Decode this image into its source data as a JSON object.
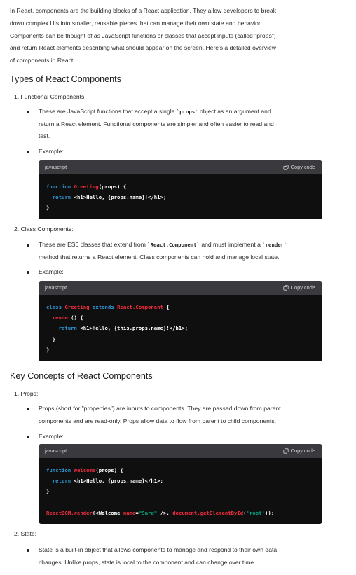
{
  "intro": [
    "In React, components are the building blocks of a React application. They allow developers to break",
    "down complex UIs into smaller, reusable pieces that can manage their own state and behavior.",
    "Components can be thought of as JavaScript functions or classes that accept inputs (called \"props\")",
    "and return React elements describing what should appear on the screen. Here's a detailed overview",
    "of components in React:"
  ],
  "section1": {
    "title": "Types of React Components",
    "item1": {
      "label": "1.  Functional Components:",
      "bullet1": {
        "line1_a": "These are JavaScript functions that accept a single ",
        "line1_code": "`props`",
        "line1_b": " object as an argument and",
        "line2": "return a React element. Functional components are simpler and often easier to read and",
        "line3": "test."
      },
      "bullet2": "Example:",
      "code": {
        "lang": "javascript",
        "copy": "Copy code",
        "l1_kw": "function ",
        "l1_fn": "Greeting",
        "l1_rest": "(props) {",
        "l2_kw": "  return ",
        "l2_rest": "<h1>Hello, {props.name}!</h1>;",
        "l3": "}"
      }
    },
    "item2": {
      "label": "2.  Class Components:",
      "bullet1": {
        "line1_a": "These are ES6 classes that extend from ",
        "line1_code1": "`React.Component`",
        "line1_b": " and must implement a ",
        "line1_code2": "`render`",
        "line2": "method that returns a React element. Class components can hold and manage local state."
      },
      "bullet2": "Example:",
      "code": {
        "lang": "javascript",
        "copy": "Copy code",
        "l1_kw": "class ",
        "l1_fn": "Greeting",
        "l1_kw2": " extends ",
        "l1_fn2": "React.Component",
        "l1_rest": " {",
        "l2_fn": "  render",
        "l2_rest": "() {",
        "l3_kw": "    return ",
        "l3_rest": "<h1>Hello, {this.props.name}!</h1>;",
        "l4": "  }",
        "l5": "}"
      }
    }
  },
  "section2": {
    "title": "Key Concepts of React Components",
    "item1": {
      "label": "1.  Props:",
      "bullet1": {
        "line1": "Props (short for \"properties\") are inputs to components. They are passed down from parent",
        "line2": "components and are read-only. Props allow data to flow from parent to child components."
      },
      "bullet2": "Example:",
      "code": {
        "lang": "javascript",
        "copy": "Copy code",
        "l1_kw": "function ",
        "l1_fn": "Welcome",
        "l1_rest": "(props) {",
        "l2_kw": "  return ",
        "l2_rest": "<h1>Hello, {props.name}</h1>;",
        "l3": "}",
        "l5_fn": "ReactDOM.render",
        "l5_a": "(<Welcome ",
        "l5_attr": "name",
        "l5_eq": "=",
        "l5_str": "\"Sara\"",
        "l5_b": " />, ",
        "l5_fn2": "document.getElementById",
        "l5_c": "(",
        "l5_str2": "'root'",
        "l5_d": "));"
      }
    },
    "item2": {
      "label": "2.  State:",
      "bullet1": {
        "line1": "State is a built-in object that allows components to manage and respond to their own data",
        "line2": "changes. Unlike props, state is local to the component and can change over time."
      }
    }
  },
  "colors": {
    "code_bg": "#0f0f0f",
    "code_header": "#3a3a3e",
    "keyword": "#2e95d3",
    "function": "#f22c3d",
    "string": "#00a67d"
  },
  "icons": {
    "copy": "copy-icon"
  }
}
